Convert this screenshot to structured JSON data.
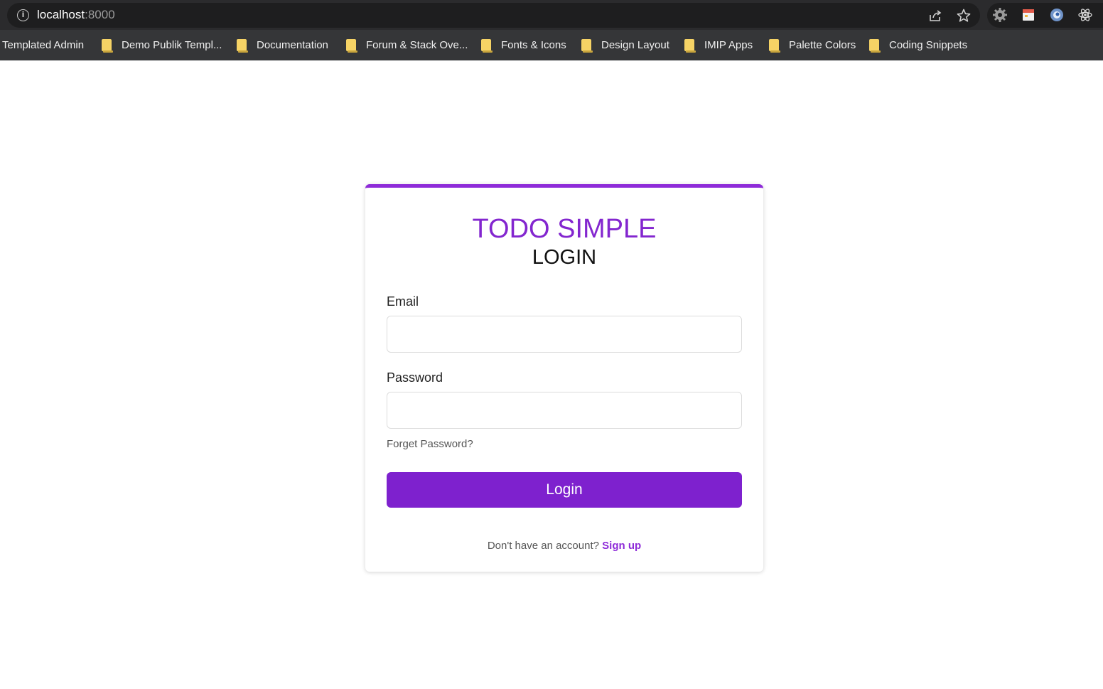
{
  "browser": {
    "url_host": "localhost",
    "url_port": ":8000",
    "icons": {
      "info": "info-icon",
      "share": "share-icon",
      "bookmark_star": "star-icon",
      "extensions": [
        "gear-extension-icon",
        "calendar-extension-icon",
        "circle-extension-icon",
        "react-extension-icon"
      ]
    },
    "colors": {
      "toolbar": "#2b2b2d",
      "bookmark_bar": "#353638",
      "folder": "#f6d365"
    }
  },
  "bookmarks": [
    {
      "label": "Templated Admin",
      "folder": false
    },
    {
      "label": "Demo Publik Templ...",
      "folder": true
    },
    {
      "label": "Documentation",
      "folder": true
    },
    {
      "label": "Forum & Stack Ove...",
      "folder": true
    },
    {
      "label": "Fonts & Icons",
      "folder": true
    },
    {
      "label": "Design Layout",
      "folder": true
    },
    {
      "label": "IMIP Apps",
      "folder": true
    },
    {
      "label": "Palette Colors",
      "folder": true
    },
    {
      "label": "Coding Snippets",
      "folder": true
    }
  ],
  "login": {
    "brand": "TODO SIMPLE",
    "title": "LOGIN",
    "email_label": "Email",
    "email_value": "",
    "password_label": "Password",
    "password_value": "",
    "forgot_link": "Forget Password?",
    "submit_label": "Login",
    "signup_prompt": "Don't have an account?",
    "signup_link": "Sign up",
    "colors": {
      "accent": "#8326cf",
      "button": "#7e21ce",
      "card_border": "#8e2bd8"
    }
  }
}
